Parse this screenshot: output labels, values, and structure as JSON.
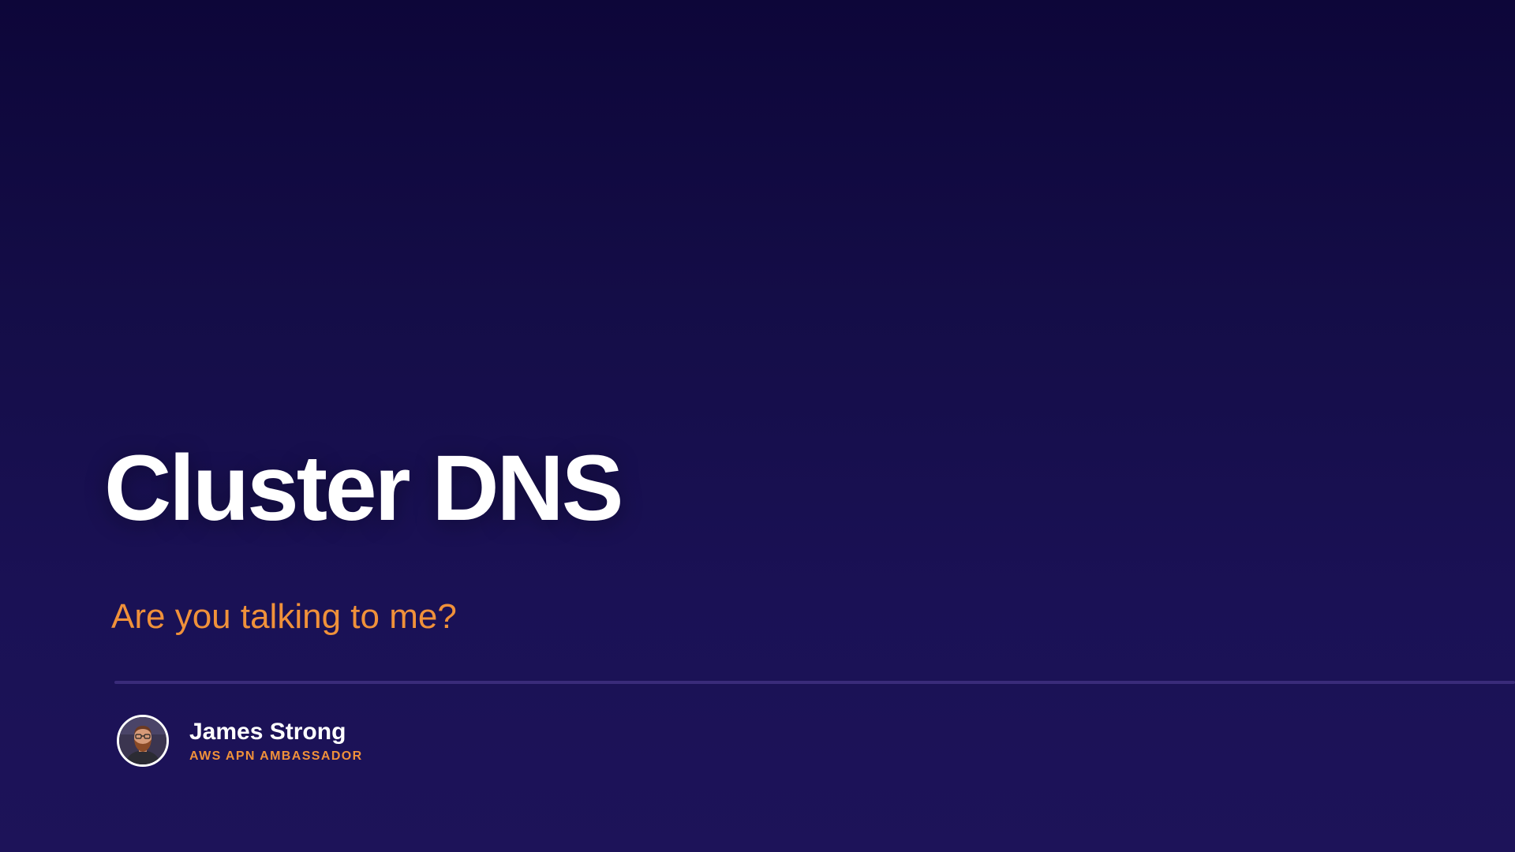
{
  "slide": {
    "title": "Cluster DNS",
    "subtitle": "Are you talking to me?",
    "speaker": {
      "name": "James Strong",
      "role": "AWS APN AMBASSADOR",
      "avatar_icon": "person-avatar-photo"
    }
  },
  "colors": {
    "background_top": "#0d0639",
    "background_bottom": "#1d1359",
    "title": "#ffffff",
    "accent": "#f0913a",
    "divider": "#3a2b7a"
  }
}
